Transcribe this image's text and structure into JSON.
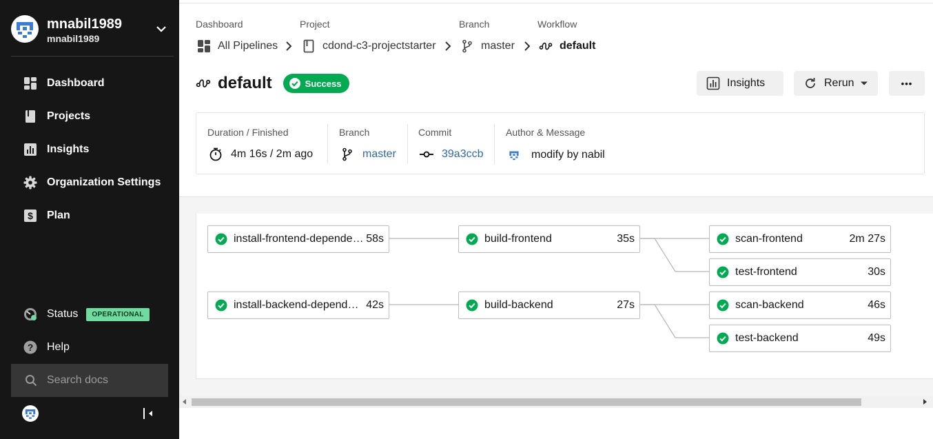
{
  "sidebar": {
    "user": {
      "name": "mnabil1989",
      "handle": "mnabil1989"
    },
    "nav": [
      {
        "label": "Dashboard",
        "icon": "dashboard-icon"
      },
      {
        "label": "Projects",
        "icon": "projects-icon"
      },
      {
        "label": "Insights",
        "icon": "insights-icon"
      },
      {
        "label": "Organization Settings",
        "icon": "gear-icon"
      },
      {
        "label": "Plan",
        "icon": "dollar-icon"
      }
    ],
    "status": {
      "label": "Status",
      "badge": "OPERATIONAL"
    },
    "help": {
      "label": "Help"
    },
    "search": {
      "placeholder": "Search docs"
    }
  },
  "breadcrumb": {
    "labels": {
      "dashboard": "Dashboard",
      "project": "Project",
      "branch": "Branch",
      "workflow": "Workflow"
    },
    "items": {
      "pipelines": "All Pipelines",
      "project": "cdond-c3-projectstarter",
      "branch": "master",
      "workflow": "default"
    }
  },
  "workflow": {
    "title": "default",
    "status": "Success",
    "insights_button": "Insights",
    "rerun_button": "Rerun",
    "more_button": "•••"
  },
  "meta": {
    "duration_label": "Duration / Finished",
    "duration_value": "4m 16s / 2m ago",
    "branch_label": "Branch",
    "branch_value": "master",
    "commit_label": "Commit",
    "commit_value": "39a3ccb",
    "author_label": "Author & Message",
    "author_value": "modify by nabil"
  },
  "jobs": [
    {
      "name": "install-frontend-dependencies",
      "duration": "58s",
      "status": "success"
    },
    {
      "name": "build-frontend",
      "duration": "35s",
      "status": "success"
    },
    {
      "name": "scan-frontend",
      "duration": "2m 27s",
      "status": "success"
    },
    {
      "name": "test-frontend",
      "duration": "30s",
      "status": "success"
    },
    {
      "name": "install-backend-dependencies",
      "duration": "42s",
      "status": "success"
    },
    {
      "name": "build-backend",
      "duration": "27s",
      "status": "success"
    },
    {
      "name": "scan-backend",
      "duration": "46s",
      "status": "success"
    },
    {
      "name": "test-backend",
      "duration": "49s",
      "status": "success"
    }
  ],
  "colors": {
    "sidebar_bg": "#161616",
    "success_green": "#04aa51",
    "operational_badge": "#6fdba0",
    "link_blue": "#2f69a7"
  }
}
